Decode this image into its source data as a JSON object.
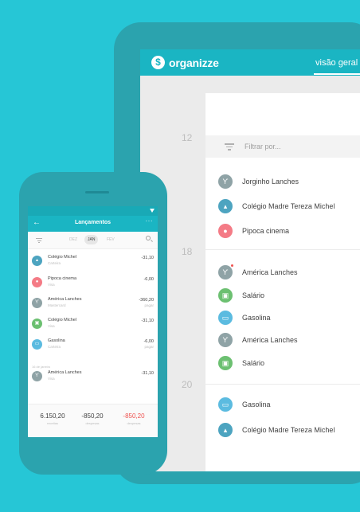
{
  "tablet": {
    "logo_mark": "$",
    "logo_text": "organizze",
    "nav_label": "visão geral",
    "days": [
      "12",
      "18",
      "20"
    ],
    "filter_placeholder": "Filtrar por...",
    "rows": [
      {
        "label": "Jorginho Lanches",
        "icon": "fork-knife-icon",
        "glyph": "ϒ",
        "color": "#8fa3a6"
      },
      {
        "label": "Colégio Madre Tereza Michel",
        "icon": "graduation-cap-icon",
        "glyph": "▴",
        "color": "#4da4c0"
      },
      {
        "label": "Pipoca cinema",
        "icon": "person-icon",
        "glyph": "●",
        "color": "#f47b86"
      },
      {
        "label": "América Lanches",
        "icon": "fork-knife-icon",
        "glyph": "ϒ",
        "color": "#8fa3a6"
      },
      {
        "label": "Salário",
        "icon": "money-icon",
        "glyph": "▣",
        "color": "#6cc071"
      },
      {
        "label": "Gasolina",
        "icon": "car-icon",
        "glyph": "▭",
        "color": "#5bbbe0"
      },
      {
        "label": "América Lanches",
        "icon": "fork-knife-icon",
        "glyph": "ϒ",
        "color": "#8fa3a6"
      },
      {
        "label": "Salário",
        "icon": "money-icon",
        "glyph": "▣",
        "color": "#6cc071"
      },
      {
        "label": "Gasolina",
        "icon": "car-icon",
        "glyph": "▭",
        "color": "#5bbbe0"
      },
      {
        "label": "Colégio Madre Tereza Michel",
        "icon": "graduation-cap-icon",
        "glyph": "▴",
        "color": "#4da4c0"
      }
    ]
  },
  "phone": {
    "back_glyph": "←",
    "title": "Lançamentos",
    "more_glyph": "···",
    "months": [
      "DEZ",
      "JAN",
      "FEV"
    ],
    "selected_month": "JAN",
    "rows": [
      {
        "name": "Colégio Michel",
        "sub": "Carteira",
        "value": "-31,10",
        "value_sub": "",
        "icon": "graduation-cap-icon",
        "glyph": "▴",
        "color": "#4da4c0"
      },
      {
        "name": "Pipoca cinema",
        "sub": "Visa",
        "value": "-6,00",
        "value_sub": "",
        "icon": "person-icon",
        "glyph": "●",
        "color": "#f47b86"
      },
      {
        "name": "América Lanches",
        "sub": "Mastercard",
        "value": "-360,20",
        "value_sub": "pagar",
        "icon": "fork-knife-icon",
        "glyph": "ϒ",
        "color": "#8fa3a6"
      },
      {
        "name": "Colégio Michel",
        "sub": "Visa",
        "value": "-31,10",
        "value_sub": "",
        "icon": "money-icon",
        "glyph": "▣",
        "color": "#6cc071"
      },
      {
        "name": "Gasolina",
        "sub": "Carteira",
        "value": "-6,00",
        "value_sub": "pagar",
        "icon": "car-icon",
        "glyph": "▭",
        "color": "#5bbbe0"
      },
      {
        "name": "América Lanches",
        "sub": "Visa",
        "value": "-31,10",
        "value_sub": "",
        "icon": "fork-knife-icon",
        "glyph": "ϒ",
        "color": "#8fa3a6"
      }
    ],
    "date_label": "16 de janeiro",
    "footer": [
      {
        "value": "6.150,20",
        "label": "receitas",
        "color": "#424242"
      },
      {
        "value": "-850,20",
        "label": "despesas",
        "color": "#424242"
      },
      {
        "value": "-850,20",
        "label": "despesas",
        "color": "#ef5350"
      }
    ]
  }
}
